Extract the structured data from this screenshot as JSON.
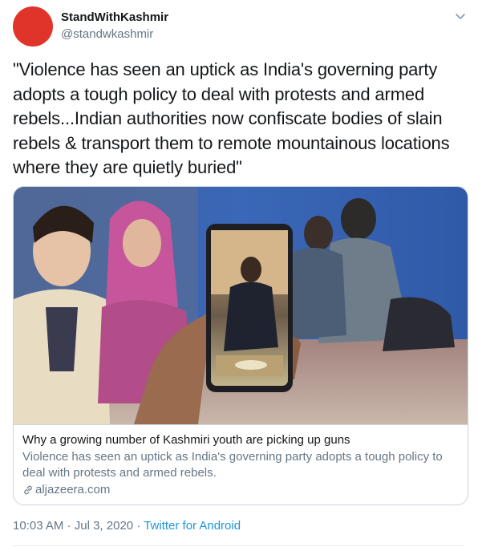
{
  "author": {
    "display_name": "StandWithKashmir",
    "handle": "@standwkashmir",
    "avatar_color": "#e0342b"
  },
  "tweet": {
    "text": "\"Violence has seen an uptick as India's governing party adopts a tough policy to deal with protests and armed rebels...Indian authorities now confiscate bodies of slain rebels & transport them to remote mountainous locations where they are quietly buried\""
  },
  "card": {
    "title": "Why a growing number of Kashmiri youth are picking up guns",
    "description": "Violence has seen an uptick as India's governing party adopts a tough policy to deal with protests and armed rebels.",
    "domain": "aljazeera.com",
    "image_icon": "photo-of-hand-holding-phone-icon"
  },
  "meta": {
    "time": "10:03 AM",
    "separator1": " · ",
    "date": "Jul 3, 2020",
    "separator2": " · ",
    "source": "Twitter for Android"
  },
  "icons": {
    "caret": "chevron-down-icon",
    "link": "link-icon"
  },
  "colors": {
    "link": "#1b95e0",
    "secondary_text": "#657786",
    "border": "#ccd6dd"
  }
}
